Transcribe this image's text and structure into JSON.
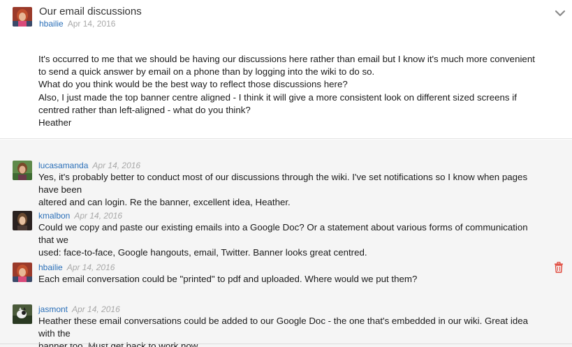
{
  "thread": {
    "title": "Our email discussions",
    "author": "hbailie",
    "date": "Apr 14, 2016",
    "body": [
      "It's occurred to me that we should be having our discussions here rather than email but I know it's much more convenient",
      "to send a quick answer by email on a phone than by logging into the wiki to do so.",
      "What do you think would be the best way to reflect those discussions here?",
      "Also, I just made the top banner centre aligned - I think it will give a more consistent look on different sized screens if",
      "centred rather than left-aligned - what do you think?",
      "Heather"
    ]
  },
  "replies": [
    {
      "author": "lucasamanda",
      "date": "Apr 14, 2016",
      "lines": [
        "Yes, it's probably better to conduct most of our discussions through the wiki. I've set notifications so I know when pages have been",
        "altered and can login. Re the banner, excellent idea, Heather."
      ]
    },
    {
      "author": "kmalbon",
      "date": "Apr 14, 2016",
      "lines": [
        "Could we copy and paste our existing emails into a Google Doc? Or a statement about various forms of communication that we",
        "used: face-to-face, Google hangouts, email, Twitter. Banner looks great centred."
      ]
    },
    {
      "author": "hbailie",
      "date": "Apr 14, 2016",
      "lines": [
        "Each email conversation could be \"printed\" to pdf and uploaded. Where would we put them?"
      ]
    },
    {
      "author": "jasmont",
      "date": "Apr 14, 2016",
      "lines": [
        "Heather these email conversations could be added to our Google Doc - the one that's embedded in our wiki. Great idea with the",
        "banner too. Must get back to work now"
      ]
    }
  ],
  "icons": {
    "collapse": "chevron-down-icon",
    "delete": "trash-icon"
  },
  "colors": {
    "author_link": "#2a6fb8",
    "date": "#a8a8a8",
    "reply_background": "#f5f5f5",
    "delete_icon": "#e0473b"
  }
}
